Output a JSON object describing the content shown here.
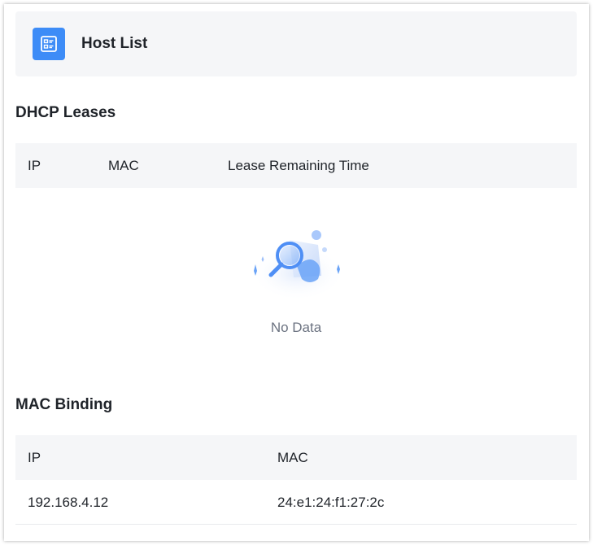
{
  "header": {
    "title": "Host List",
    "icon": "host-list-icon"
  },
  "dhcp": {
    "title": "DHCP Leases",
    "columns": [
      "IP",
      "MAC",
      "Lease Remaining Time"
    ],
    "rows": [],
    "empty_text": "No Data"
  },
  "binding": {
    "title": "MAC Binding",
    "columns": [
      "IP",
      "MAC"
    ],
    "rows": [
      {
        "ip": "192.168.4.12",
        "mac": "24:e1:24:f1:27:2c"
      }
    ]
  },
  "colors": {
    "accent": "#3d8cf7",
    "header_bg": "#f5f6f8"
  }
}
